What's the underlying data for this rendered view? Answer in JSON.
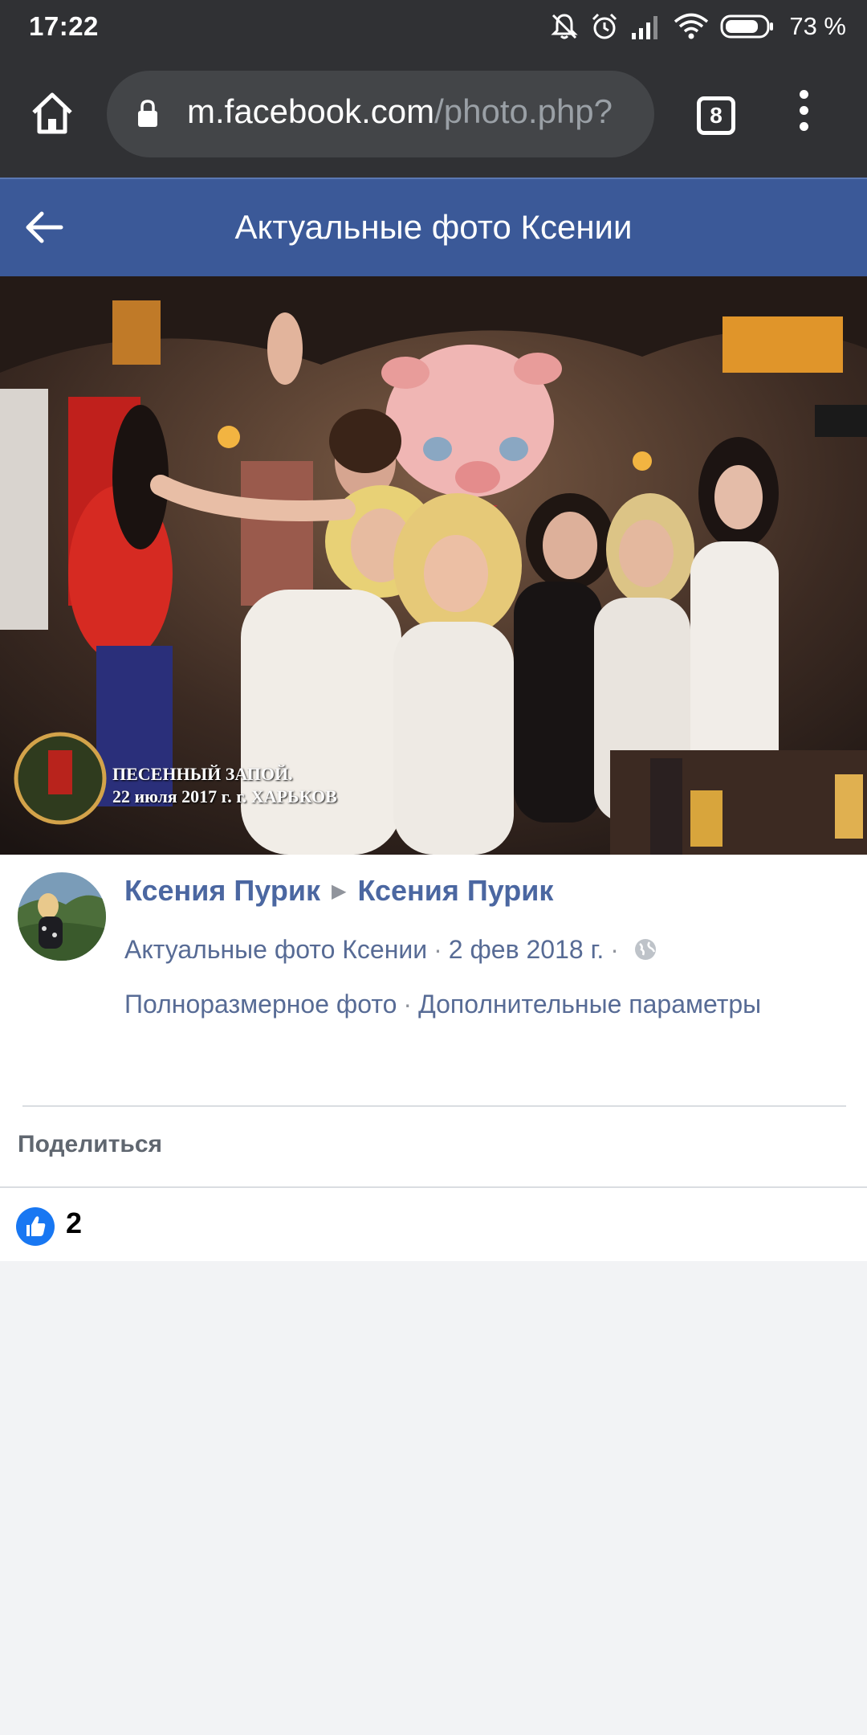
{
  "status": {
    "time": "17:22",
    "battery": "73 %",
    "icons": [
      "mute-icon",
      "alarm-icon",
      "signal-icon",
      "wifi-icon",
      "battery-icon"
    ]
  },
  "browser": {
    "url_host": "m.facebook.com",
    "url_path": "/photo.php?",
    "tab_count": "8"
  },
  "header": {
    "title": "Актуальные фото Ксении"
  },
  "photo": {
    "caption_line1": "ПЕСЕННЫЙ ЗАПОЙ.",
    "caption_line2": "22 июля 2017 г. г. ХАРЬКОВ"
  },
  "post": {
    "author": "Ксения Пурик",
    "target": "Ксения Пурик",
    "album": "Актуальные фото Ксении",
    "date": "2 фев 2018 г.",
    "full_size": "Полноразмерное фото",
    "more_options": "Дополнительные параметры",
    "share": "Поделиться",
    "likes": "2"
  },
  "colors": {
    "fb_blue": "#3b5998",
    "link_blue": "#4b67a1",
    "like_blue": "#1877f2"
  }
}
